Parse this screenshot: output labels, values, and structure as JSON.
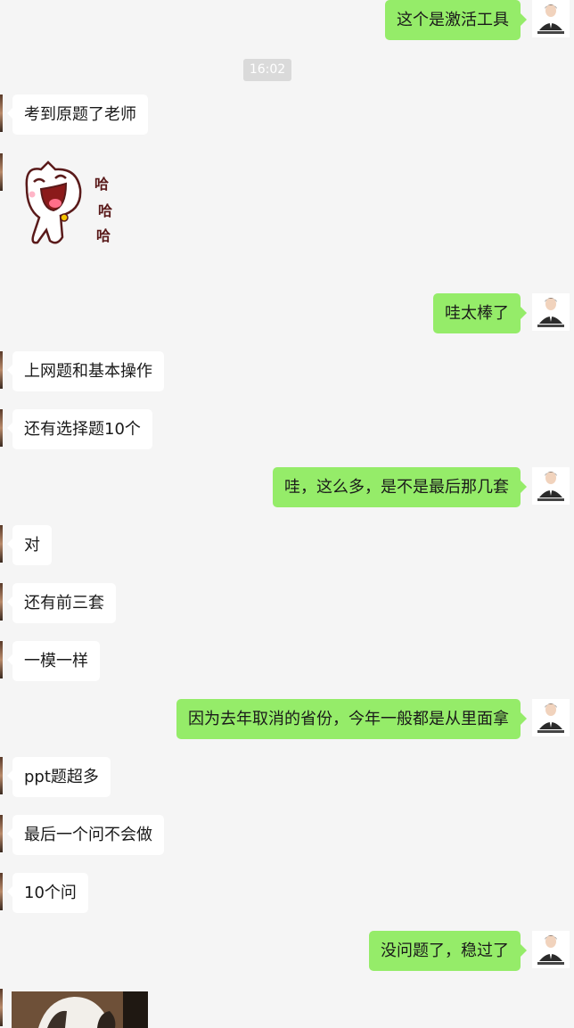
{
  "timestamp": "16:02",
  "sticker_text": [
    "哈",
    "哈",
    "哈"
  ],
  "messages": [
    {
      "side": "right",
      "text": "这个是激活工具"
    },
    {
      "side": "left",
      "text": "考到原题了老师"
    },
    {
      "side": "right",
      "text": "哇太棒了"
    },
    {
      "side": "left",
      "text": "上网题和基本操作"
    },
    {
      "side": "left",
      "text": "还有选择题10个"
    },
    {
      "side": "right",
      "text": "哇，这么多，是不是最后那几套"
    },
    {
      "side": "left",
      "text": "对"
    },
    {
      "side": "left",
      "text": "还有前三套"
    },
    {
      "side": "left",
      "text": "一模一样"
    },
    {
      "side": "right",
      "text": "因为去年取消的省份，今年一般都是从里面拿"
    },
    {
      "side": "left",
      "text": "ppt题超多"
    },
    {
      "side": "left",
      "text": "最后一个问不会做"
    },
    {
      "side": "left",
      "text": "10个问"
    },
    {
      "side": "right",
      "text": "没问题了，稳过了"
    }
  ],
  "colors": {
    "background": "#f5f5f5",
    "sent_bubble": "#95ec69",
    "received_bubble": "#ffffff",
    "timestamp_bg": "#dadada"
  }
}
